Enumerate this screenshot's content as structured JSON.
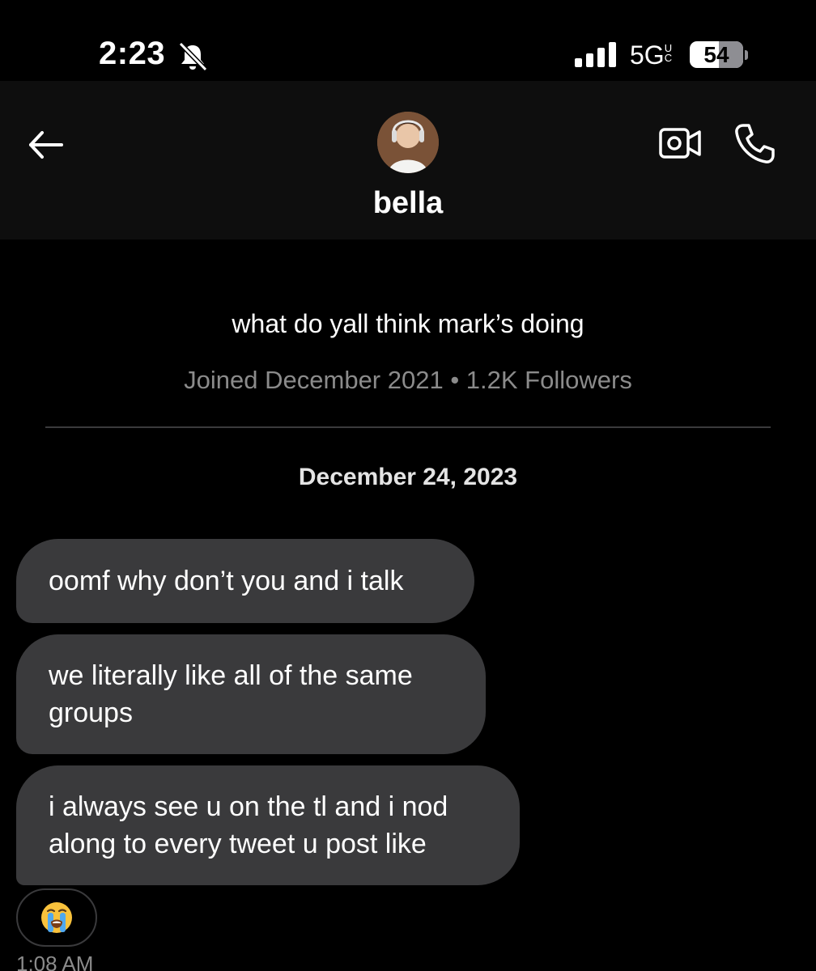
{
  "status_bar": {
    "time": "2:23",
    "network": "5G",
    "network_suffix": "UC",
    "battery": "54",
    "battery_fraction": 0.54,
    "icons": [
      "bell-slash-icon",
      "cellular-signal-icon"
    ]
  },
  "header": {
    "name": "bella",
    "icons": [
      "back-arrow-icon",
      "video-camera-icon",
      "phone-icon"
    ]
  },
  "profile": {
    "bio": "what do yall think mark’s doing",
    "meta": "Joined December 2021 • 1.2K Followers"
  },
  "conversation": {
    "date": "December 24, 2023",
    "messages": [
      {
        "text": "oomf why don’t you and i talk"
      },
      {
        "text": "we literally like all of the same groups"
      },
      {
        "text": "i always see u on the tl and i nod along to every tweet u post like"
      }
    ],
    "reaction": "😭",
    "timestamp": "1:08 AM"
  },
  "colors": {
    "background": "#000000",
    "header_bg": "#0e0e0e",
    "bubble_bg": "#3a3a3c",
    "secondary_text": "#8b8b8b"
  }
}
